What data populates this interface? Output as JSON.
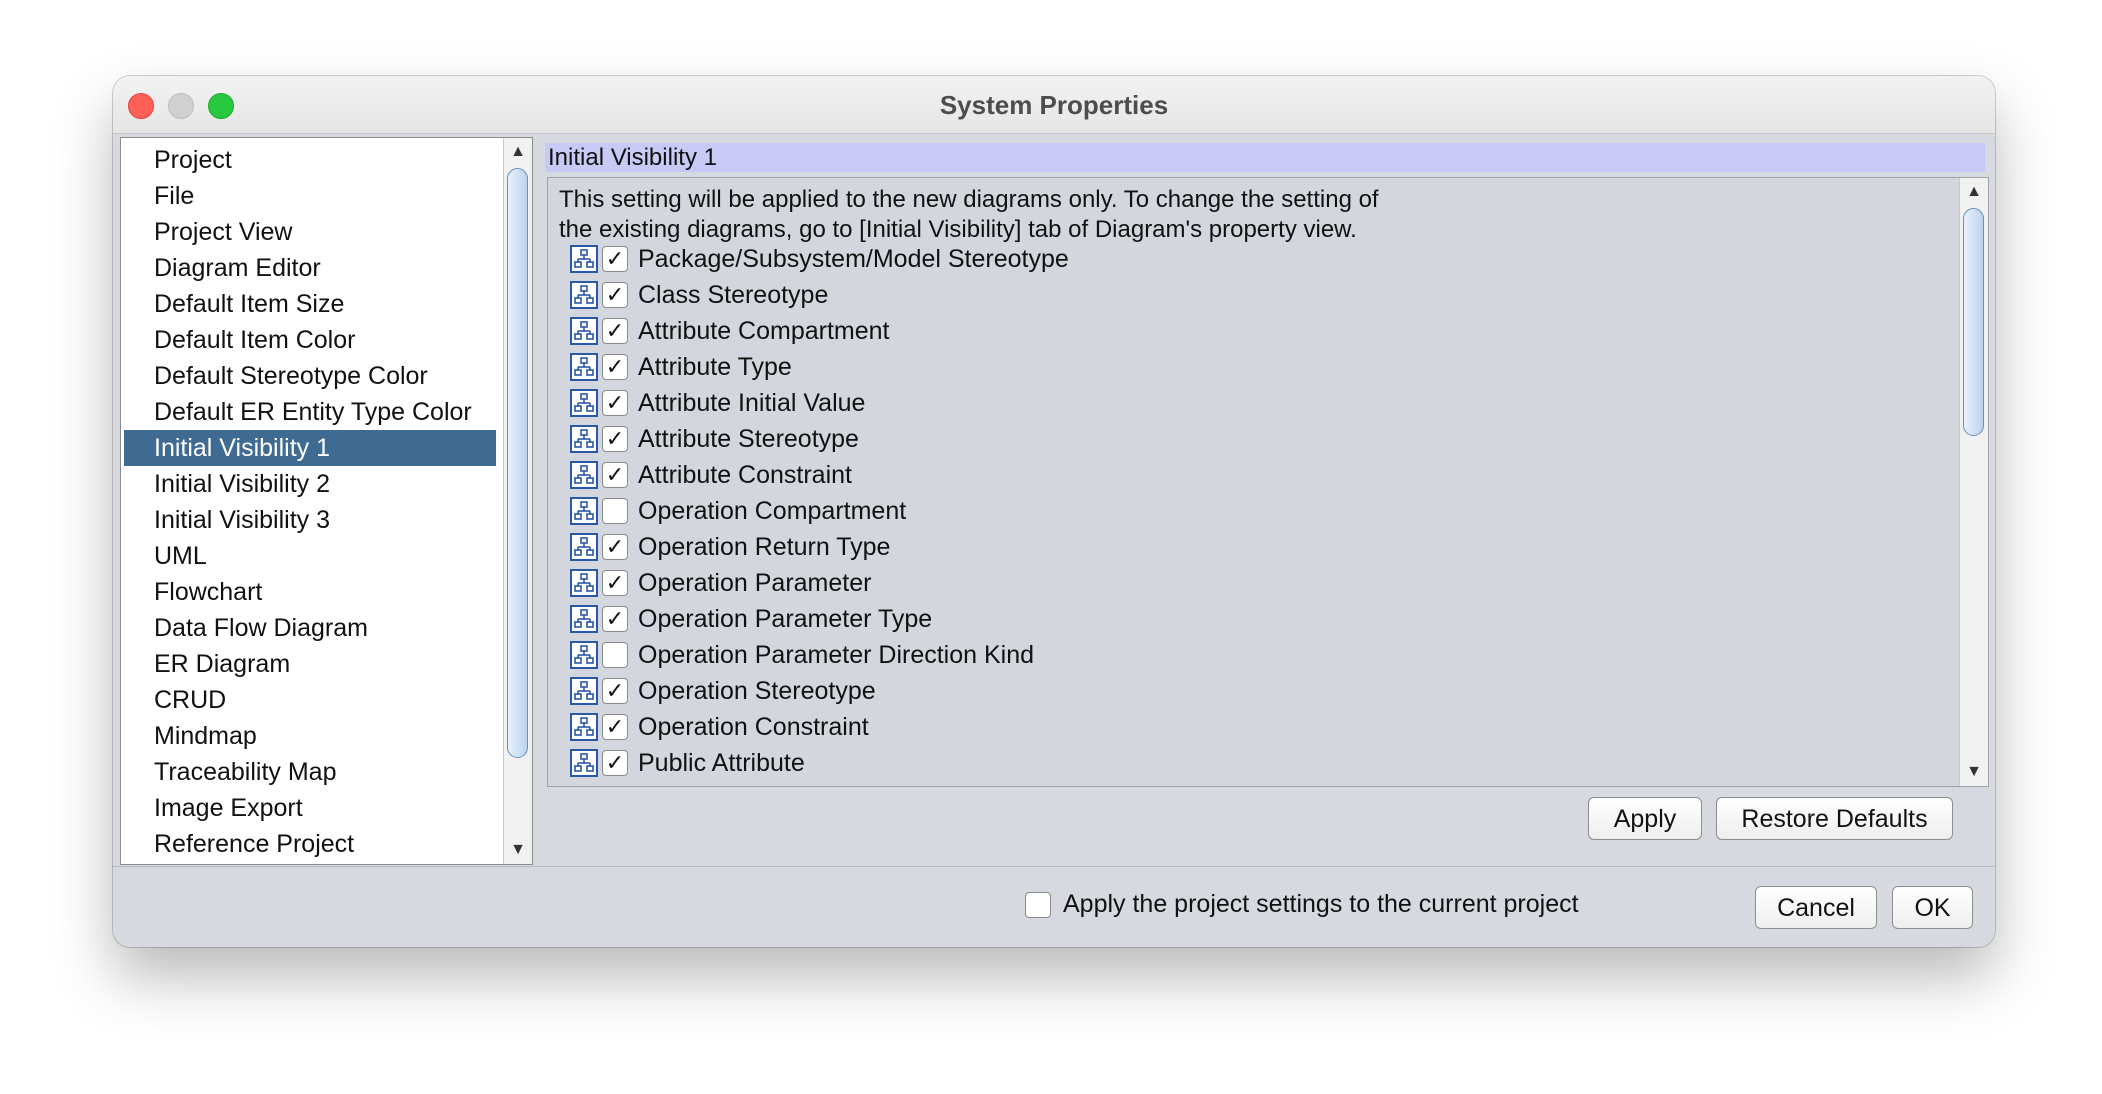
{
  "window": {
    "title": "System Properties"
  },
  "categories": {
    "items": [
      "Project",
      "File",
      "Project View",
      "Diagram Editor",
      "Default Item Size",
      "Default Item Color",
      "Default Stereotype Color",
      "Default ER Entity Type Color",
      "Initial Visibility 1",
      "Initial Visibility 2",
      "Initial Visibility 3",
      "UML",
      "Flowchart",
      "Data Flow Diagram",
      "ER Diagram",
      "CRUD",
      "Mindmap",
      "Traceability Map",
      "Image Export",
      "Reference Project"
    ],
    "selected": "Initial Visibility 1"
  },
  "panel": {
    "header": "Initial Visibility 1",
    "description_line1": "This setting will be applied to the new diagrams only. To change the setting of",
    "description_line2": "the existing diagrams, go to [Initial Visibility] tab of Diagram's property view.",
    "settings": [
      {
        "label": "Package/Subsystem/Model Stereotype",
        "checked": true
      },
      {
        "label": "Class Stereotype",
        "checked": true
      },
      {
        "label": "Attribute Compartment",
        "checked": true
      },
      {
        "label": "Attribute Type",
        "checked": true
      },
      {
        "label": "Attribute Initial Value",
        "checked": true
      },
      {
        "label": "Attribute Stereotype",
        "checked": true
      },
      {
        "label": "Attribute Constraint",
        "checked": true
      },
      {
        "label": "Operation Compartment",
        "checked": false
      },
      {
        "label": "Operation Return Type",
        "checked": true
      },
      {
        "label": "Operation Parameter",
        "checked": true
      },
      {
        "label": "Operation Parameter Type",
        "checked": true
      },
      {
        "label": "Operation Parameter Direction Kind",
        "checked": false
      },
      {
        "label": "Operation Stereotype",
        "checked": true
      },
      {
        "label": "Operation Constraint",
        "checked": true
      },
      {
        "label": "Public Attribute",
        "checked": true
      }
    ],
    "apply_label": "Apply",
    "restore_label": "Restore Defaults"
  },
  "footer": {
    "apply_project_label": "Apply the project settings to the current project",
    "apply_project_checked": false,
    "cancel_label": "Cancel",
    "ok_label": "OK"
  },
  "icons": {
    "setting_icon": "diagram-tree-icon",
    "check_glyph": "✓",
    "scroll_up": "▲",
    "scroll_down": "▼"
  },
  "colors": {
    "selection": "#3f6a92",
    "header_bar": "#c8c9f5",
    "icon_blue": "#2a58a8"
  }
}
